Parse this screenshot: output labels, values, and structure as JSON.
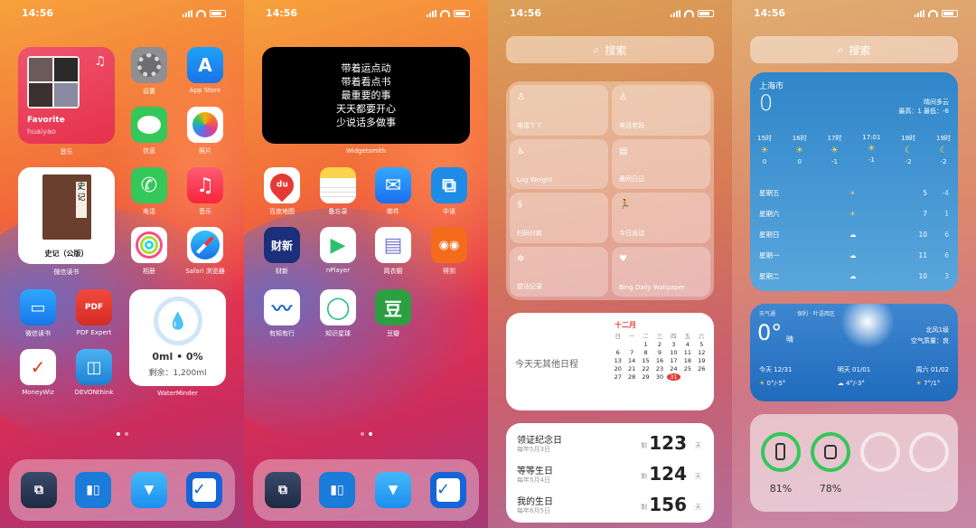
{
  "status": {
    "time": "14:56"
  },
  "screen1": {
    "music": {
      "title": "Favorite",
      "artist": "huaiyao",
      "label": "音乐"
    },
    "apps": [
      {
        "label": "设置"
      },
      {
        "label": "App Store"
      },
      {
        "label": "信息"
      },
      {
        "label": "照片"
      },
      {
        "label": "电话"
      },
      {
        "label": "音乐"
      },
      {
        "label": "相册"
      },
      {
        "label": "Safari 浏览器"
      },
      {
        "label": "微信读书"
      },
      {
        "label": "PDF Expert"
      },
      {
        "label": "MoneyWiz"
      },
      {
        "label": "DEVONthink"
      }
    ],
    "book": {
      "glyph": "史记",
      "title": "史记（公版）",
      "label": "微信读书"
    },
    "water": {
      "value": "0ml • 0%",
      "remain": "剩余：1,200ml",
      "label": "WaterMinder"
    }
  },
  "screen2": {
    "note": {
      "lines": [
        "带着运点动",
        "带着看点书",
        "最重要的事",
        "天天都要开心",
        "少说话多做事"
      ],
      "label": "Widgetsmith"
    },
    "apps": [
      {
        "label": "百度地图",
        "glyph": "du"
      },
      {
        "label": "备忘录",
        "glyph": ""
      },
      {
        "label": "邮件",
        "glyph": "✉"
      },
      {
        "label": "中读",
        "glyph": "⧉"
      },
      {
        "label": "财新",
        "glyph": "财新"
      },
      {
        "label": "nPlayer",
        "glyph": "▶"
      },
      {
        "label": "简衣橱",
        "glyph": "▤"
      },
      {
        "label": "得到",
        "glyph": "◉◉"
      },
      {
        "label": "有知有行",
        "glyph": "〰"
      },
      {
        "label": "知识星球",
        "glyph": "◯"
      },
      {
        "label": "豆瓣",
        "glyph": "豆"
      }
    ]
  },
  "screen3": {
    "search": "搜索",
    "shortcuts": [
      {
        "label": "电话丫丫",
        "icon": "♙"
      },
      {
        "label": "电话老妈",
        "icon": "♙"
      },
      {
        "label": "Log Weight",
        "icon": "♿"
      },
      {
        "label": "晨间日记",
        "icon": "▤"
      },
      {
        "label": "扫码付款",
        "icon": "$"
      },
      {
        "label": "今日运动",
        "icon": "🏃"
      },
      {
        "label": "想法记录",
        "icon": "✲"
      },
      {
        "label": "Bing Daily Wallpaper",
        "icon": "♥"
      }
    ],
    "calendar": {
      "empty": "今天无其他日程",
      "month": "十二月",
      "weekdays": [
        "日",
        "一",
        "二",
        "三",
        "四",
        "五",
        "六"
      ],
      "days": [
        "",
        "",
        "1",
        "2",
        "3",
        "4",
        "5",
        "6",
        "7",
        "8",
        "9",
        "10",
        "11",
        "12",
        "13",
        "14",
        "15",
        "16",
        "17",
        "18",
        "19",
        "20",
        "21",
        "22",
        "23",
        "24",
        "25",
        "26",
        "27",
        "28",
        "29",
        "30",
        "31",
        "",
        ""
      ],
      "today": "31"
    },
    "countdown": [
      {
        "name": "领证纪念日",
        "date": "每年5月3日",
        "prefix": "剩",
        "num": "123",
        "unit": "天"
      },
      {
        "name": "等等生日",
        "date": "每年5月4日",
        "prefix": "剩",
        "num": "124",
        "unit": "天"
      },
      {
        "name": "我的生日",
        "date": "每年6月5日",
        "prefix": "剩",
        "num": "156",
        "unit": "天"
      }
    ]
  },
  "screen4": {
    "search": "搜索",
    "weather": {
      "city": "上海市",
      "temp": "0",
      "cond": "晴间多云",
      "hilo": "最高：1 最低：-6",
      "hours": [
        {
          "t": "15时",
          "i": "☀",
          "v": "0"
        },
        {
          "t": "16时",
          "i": "☀",
          "v": "0"
        },
        {
          "t": "17时",
          "i": "☀",
          "v": "-1"
        },
        {
          "t": "17:01",
          "i": "☀",
          "v": "-1"
        },
        {
          "t": "18时",
          "i": "☾",
          "v": "-2"
        },
        {
          "t": "19时",
          "i": "☾",
          "v": "-2"
        }
      ],
      "days": [
        {
          "d": "星期五",
          "i": "☀",
          "h": "5",
          "l": "-4"
        },
        {
          "d": "星期六",
          "i": "☀",
          "h": "7",
          "l": "1"
        },
        {
          "d": "星期日",
          "i": "☁",
          "h": "10",
          "l": "6"
        },
        {
          "d": "星期一",
          "i": "☁",
          "h": "11",
          "l": "6"
        },
        {
          "d": "星期二",
          "i": "☁",
          "h": "10",
          "l": "3"
        }
      ]
    },
    "weather2": {
      "src": "天气通",
      "loc": "保利 · 叶语西区",
      "temp": "0°",
      "cond": "晴",
      "wind": "北风1级",
      "aqi": "空气质量：良",
      "days": [
        {
          "d": "今天",
          "date": "12/31",
          "i": "☀",
          "r": "0°/-5°"
        },
        {
          "d": "明天",
          "date": "01/01",
          "i": "☁",
          "r": "4°/-3°"
        },
        {
          "d": "周六",
          "date": "01/02",
          "i": "☀",
          "r": "7°/1°"
        }
      ]
    },
    "battery": [
      {
        "dev": "phone",
        "pct": "81%",
        "v": 0.81
      },
      {
        "dev": "watch",
        "pct": "78%",
        "v": 0.78
      },
      {
        "dev": "",
        "pct": ""
      },
      {
        "dev": "",
        "pct": ""
      }
    ]
  },
  "dock": [
    {
      "name": "scrivener"
    },
    {
      "name": "trello"
    },
    {
      "name": "bookmark"
    },
    {
      "name": "things"
    }
  ]
}
